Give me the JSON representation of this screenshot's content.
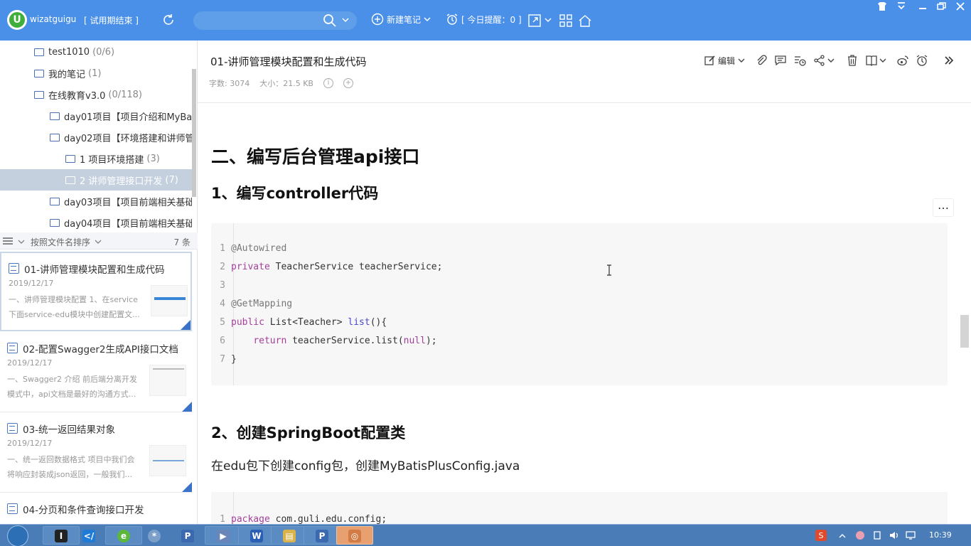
{
  "topbar": {
    "user": "wizatguigu",
    "trial": "[ 试用期结束 ]",
    "new_note": "新建笔记",
    "remind": "[ 今日提醒：0 ]"
  },
  "sidebar": {
    "tree": [
      {
        "label": "test1010",
        "count": "(0/6)"
      },
      {
        "label": "我的笔记",
        "count": "(1)"
      },
      {
        "label": "在线教育v3.0",
        "count": "(0/118)"
      },
      {
        "label": "day01项目【项目介绍和MyBat",
        "count": ""
      },
      {
        "label": "day02项目【环境搭建和讲师管",
        "count": ""
      },
      {
        "label": "1 项目环境搭建",
        "count": "(3)"
      },
      {
        "label": "2 讲师管理接口开发",
        "count": "(7)"
      },
      {
        "label": "day03项目【项目前端相关基础",
        "count": ""
      },
      {
        "label": "day04项目【项目前端相关基础",
        "count": ""
      }
    ],
    "sort_label": "按照文件名排序",
    "note_count": "7 条",
    "notes": [
      {
        "title": "01-讲师管理模块配置和生成代码",
        "date": "2019/12/17",
        "snippet1": "一、讲师管理模块配置 1、在service",
        "snippet2": "下面service-edu模块中创建配置文..."
      },
      {
        "title": "02-配置Swagger2生成API接口文档",
        "date": "2019/12/17",
        "snippet1": "一、Swagger2 介绍 前后端分离开发",
        "snippet2": "模式中，api文档是最好的沟通方式..."
      },
      {
        "title": "03-统一返回结果对象",
        "date": "2019/12/17",
        "snippet1": "一、统一返回数据格式 项目中我们会",
        "snippet2": "将响应封装成json返回，一般我们..."
      },
      {
        "title": "04-分页和条件查询接口开发",
        "date": "",
        "snippet1": "",
        "snippet2": ""
      }
    ]
  },
  "doc": {
    "title": "01-讲师管理模块配置和生成代码",
    "words": "字数: 3074",
    "size": "大小：21.5 KB",
    "edit_label": "编辑",
    "h1": "二、编写后台管理api接口",
    "h2_1": "1、编写controller代码",
    "h2_2": "2、创建SpringBoot配置类",
    "para": "在edu包下创建config包，创建MyBatisPlusConfig.java",
    "code1": [
      {
        "n": "1",
        "a": "@Autowired"
      },
      {
        "n": "2",
        "k": "private",
        "t": " TeacherService teacherService;"
      },
      {
        "n": "3"
      },
      {
        "n": "4",
        "a": "@GetMapping"
      },
      {
        "n": "5",
        "k": "public",
        "t": " List<Teacher> ",
        "f": "list",
        "r": "(){"
      },
      {
        "n": "6",
        "i": "    ",
        "k": "return",
        "t": " teacherService.list(",
        "l": "null",
        "r": ");"
      },
      {
        "n": "7",
        "t": "}"
      }
    ],
    "code2": [
      {
        "n": "1",
        "k": "package",
        "t": " com.guli.edu.config;"
      }
    ]
  },
  "taskbar": {
    "time": "10:39"
  }
}
